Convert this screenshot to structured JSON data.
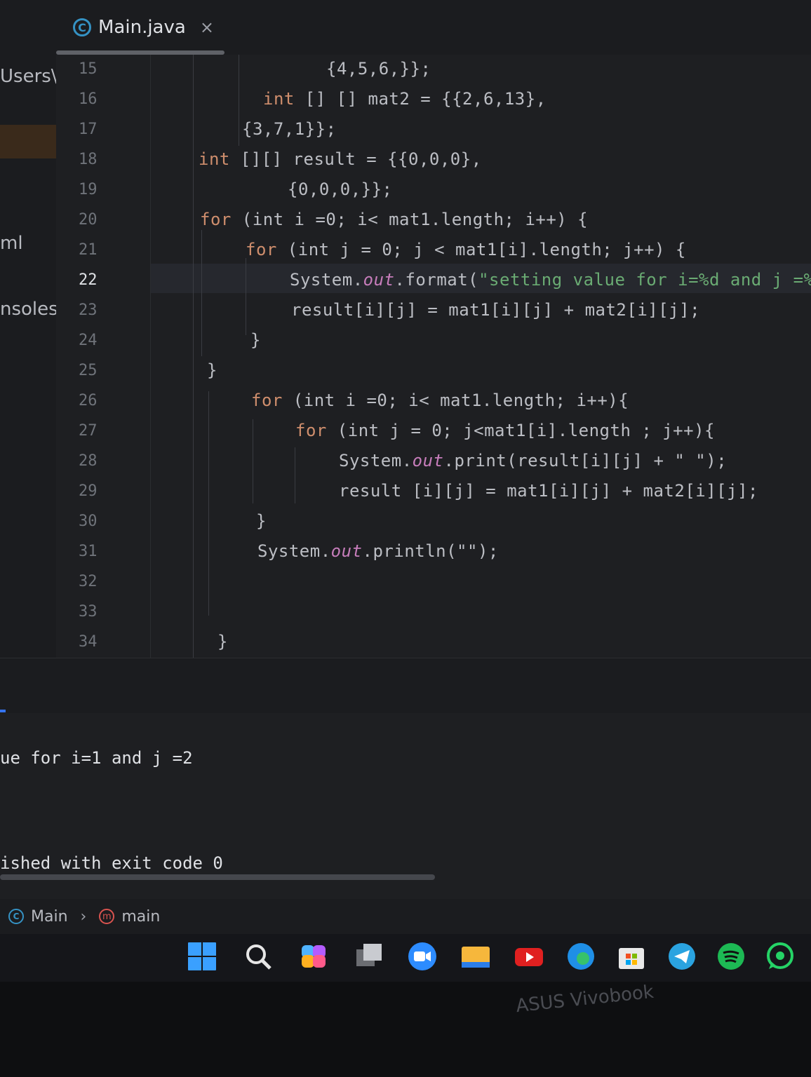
{
  "tab": {
    "label": "Main.java",
    "icon": "class-icon",
    "close": "×"
  },
  "sidebar": {
    "items": [
      "Users\\",
      "ml",
      "nsoles"
    ]
  },
  "gutter": {
    "line_numbers": [
      "15",
      "16",
      "17",
      "18",
      "19",
      "20",
      "21",
      "22",
      "23",
      "24",
      "25",
      "26",
      "27",
      "28",
      "29",
      "30",
      "31",
      "32",
      "33",
      "34"
    ],
    "current_line": "22"
  },
  "code": {
    "l15": "{4,5,6,}};",
    "l16_kw": "int",
    "l16_rest": " [] [] mat2 = {{2,6,13},",
    "l17": "{3,7,1}};",
    "l18_kw": "int",
    "l18_rest": " [][] result = {{0,0,0},",
    "l19": "{0,0,0,}};",
    "l20_kw": "for",
    "l20_rest": " (int i =0; i< mat1.length; i++) {",
    "l21_kw": "for",
    "l21_rest": " (int j = 0; j < mat1[i].length; j++) {",
    "l22_pre": "System.",
    "l22_out": "out",
    "l22_mid": ".format(",
    "l22_str": "\"setting value for i=%d and j =%d\\",
    "l23": "result[i][j] = mat1[i][j] + mat2[i][j];",
    "l24": "}",
    "l25": "}",
    "l26_kw": "for",
    "l26_rest": " (int i =0; i< mat1.length; i++){",
    "l27_kw": "for",
    "l27_rest": " (int j = 0; j<mat1[i].length ; j++){",
    "l28_pre": "System.",
    "l28_out": "out",
    "l28_rest": ".print(result[i][j] + \" \");",
    "l29": "result [i][j] = mat1[i][j] + mat2[i][j];",
    "l30": "}",
    "l31_pre": "System.",
    "l31_out": "out",
    "l31_rest": ".println(\"\");",
    "l34": "}"
  },
  "console": {
    "line1": "ue for i=1 and j =2",
    "line2": "ished with exit code 0"
  },
  "breadcrumb": {
    "class": "Main",
    "method": "main",
    "method_icon": "m"
  },
  "taskbar": {
    "icons": [
      "windows-start-icon",
      "search-icon",
      "copilot-icon",
      "task-view-icon",
      "zoom-icon",
      "file-explorer-icon",
      "youtube-icon",
      "edge-icon",
      "microsoft-store-icon",
      "telegram-icon",
      "spotify-icon",
      "whatsapp-icon"
    ]
  },
  "brand": "ASUS Vivobook",
  "colors": {
    "keyword": "#cf8e6d",
    "number": "#2aacb8",
    "field": "#c77dbb",
    "string": "#6aab73",
    "background": "#1e1f22"
  }
}
